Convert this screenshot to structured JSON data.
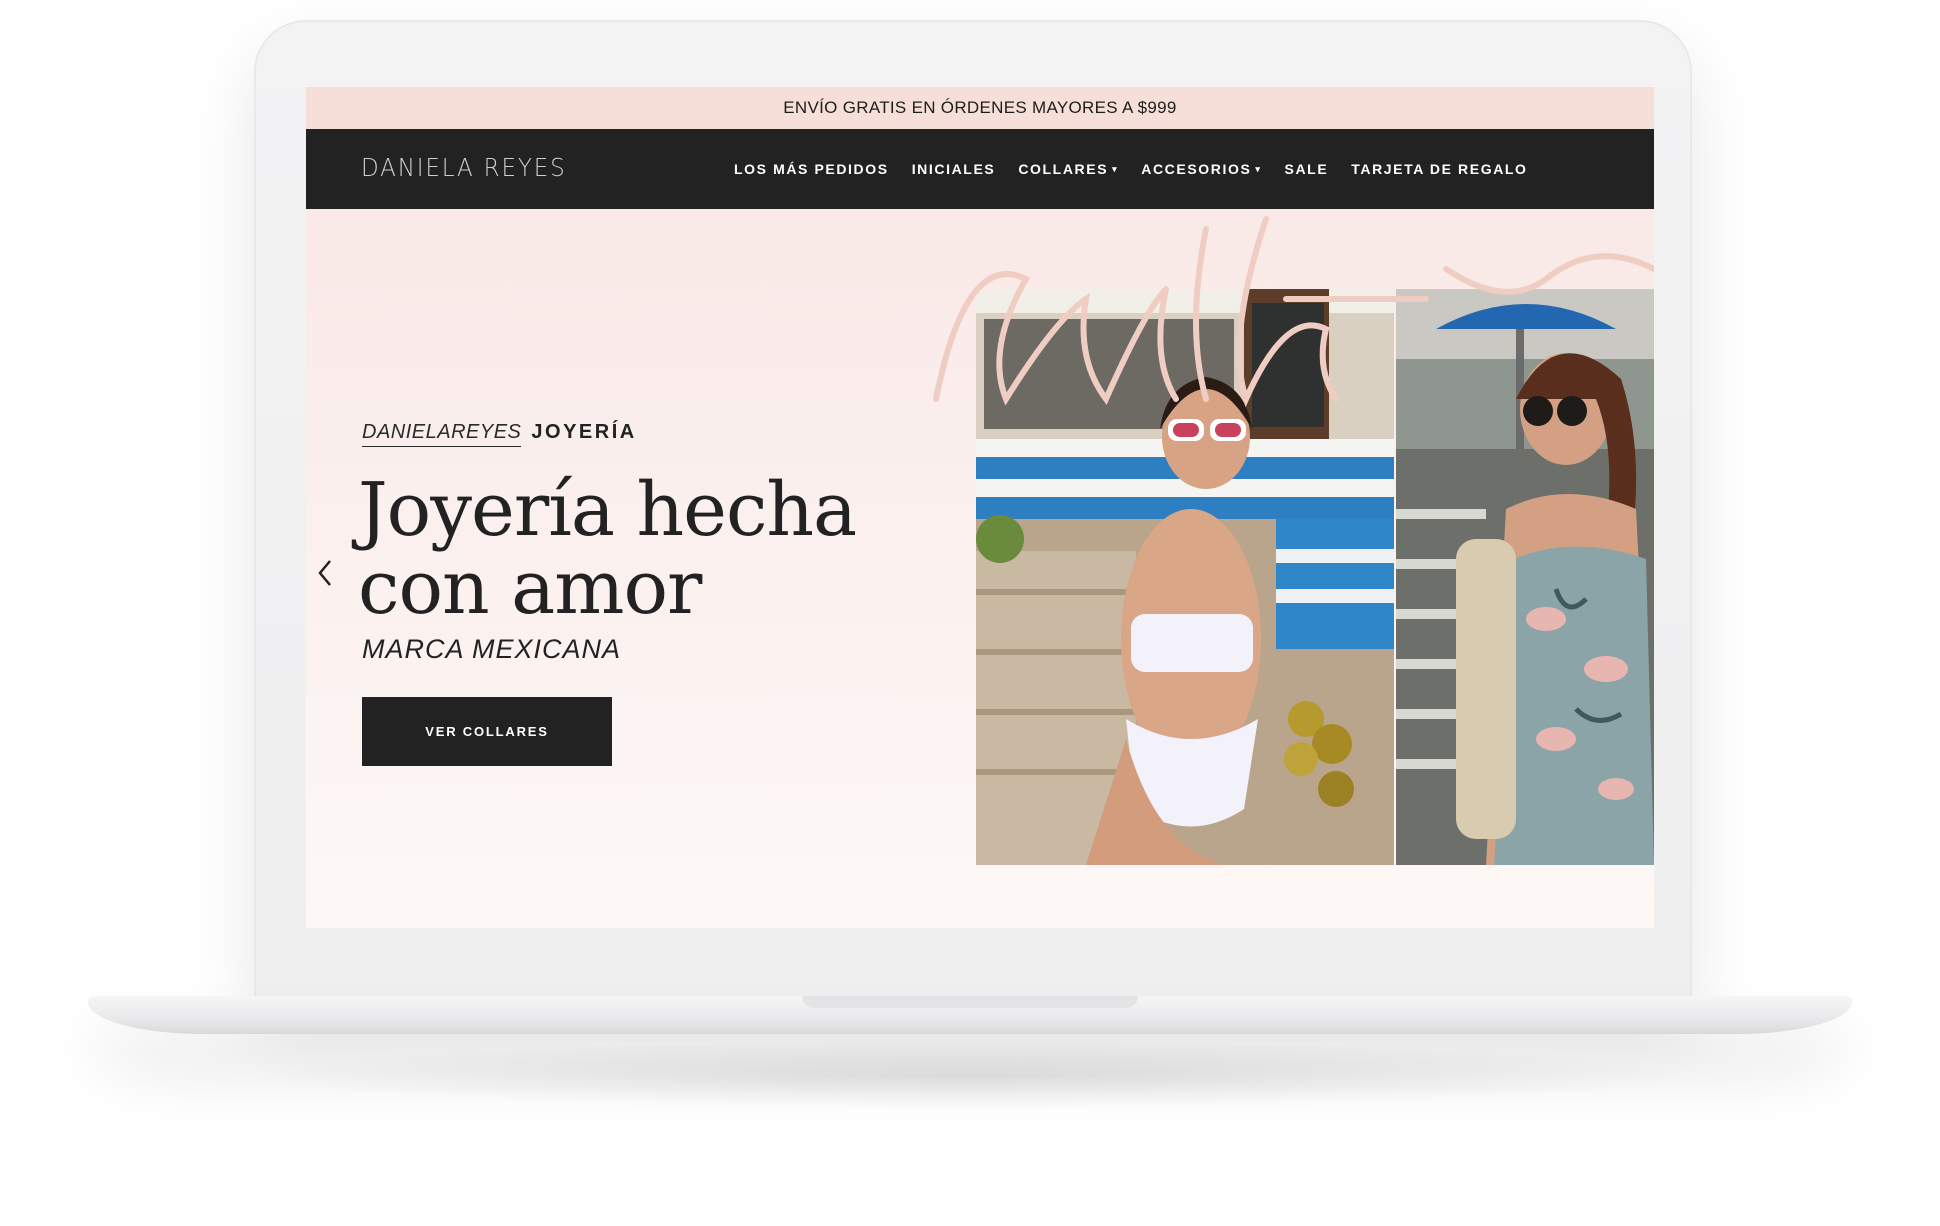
{
  "announcement": {
    "text": "ENVÍO GRATIS EN ÓRDENES MAYORES A $999"
  },
  "header": {
    "logo": "DANIELA REYES",
    "nav": [
      {
        "label": "LOS MÁS PEDIDOS"
      },
      {
        "label": "INICIALES"
      },
      {
        "label": "COLLARES",
        "caret": "▾"
      },
      {
        "label": "ACCESORIOS",
        "caret": "▾"
      },
      {
        "label": "SALE"
      },
      {
        "label": "TARJETA DE REGALO"
      }
    ]
  },
  "hero": {
    "eyebrow_brand": "DANIELAREYES",
    "eyebrow_tag": "JOYERÍA",
    "headline": "Joyería hecha con amor",
    "subhead": "MARCA MEXICANA",
    "cta_label": "VER COLLARES"
  },
  "icons": {
    "prev": "chevron-left-icon",
    "dropdown": "caret-down-icon"
  },
  "colors": {
    "announcement_bg": "#f6dfd8",
    "nav_bg": "#222222",
    "hero_bg": "#f9e9e7",
    "button_bg": "#222222",
    "script_accent": "#f0cdc3"
  }
}
